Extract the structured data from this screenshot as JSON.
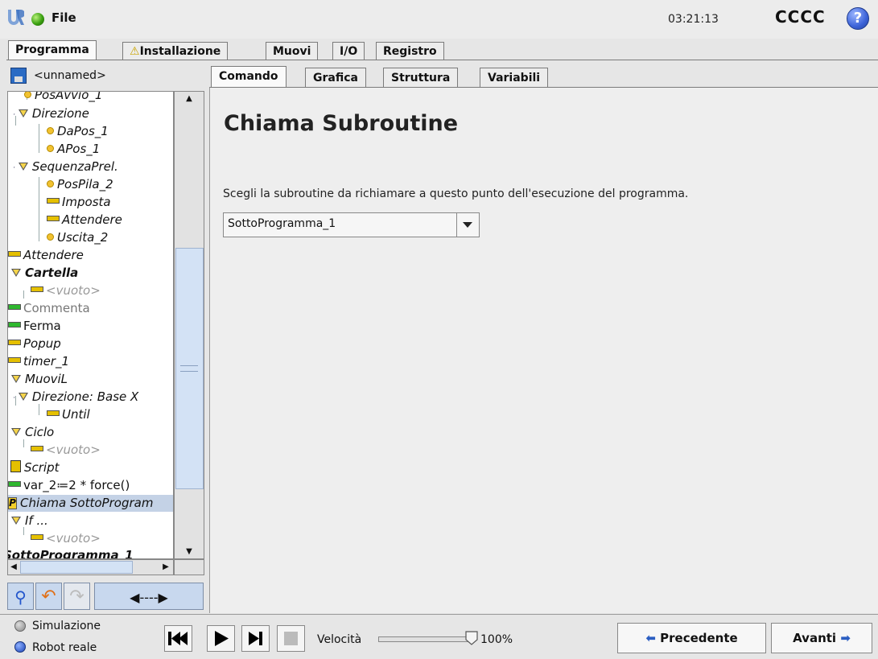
{
  "header": {
    "file_label": "File",
    "time": "03:21:13",
    "robot_name": "CCCC",
    "help_glyph": "?"
  },
  "main_tabs": [
    {
      "label": "Programma",
      "active": true
    },
    {
      "label": "Installazione",
      "warning": true
    },
    {
      "label": "Muovi"
    },
    {
      "label": "I/O"
    },
    {
      "label": "Registro"
    }
  ],
  "program": {
    "name": "<unnamed>"
  },
  "tree": [
    {
      "text": "PosAvvio_1",
      "icon": "waypoint-icon",
      "style": "italic"
    },
    {
      "text": "Direzione",
      "icon": "folder-triangle-icon",
      "style": "italic"
    },
    {
      "text": "DaPos_1",
      "icon": "waypoint-icon",
      "style": "italic"
    },
    {
      "text": "APos_1",
      "icon": "waypoint-icon",
      "style": "italic"
    },
    {
      "text": "SequenzaPrel.",
      "icon": "folder-triangle-icon",
      "style": "italic"
    },
    {
      "text": "PosPila_2",
      "icon": "waypoint-icon",
      "style": "italic"
    },
    {
      "text": "Imposta",
      "icon": "yellow-bar-icon",
      "style": "italic"
    },
    {
      "text": "Attendere",
      "icon": "yellow-bar-icon",
      "style": "italic"
    },
    {
      "text": "Uscita_2",
      "icon": "waypoint-icon",
      "style": "italic"
    },
    {
      "text": "Attendere",
      "icon": "yellow-bar-icon",
      "style": "italic"
    },
    {
      "text": "Cartella",
      "icon": "folder-triangle-icon",
      "style": "boldit"
    },
    {
      "text": "<vuoto>",
      "icon": "yellow-bar-icon",
      "style": "italic-gray"
    },
    {
      "text": "Commenta",
      "icon": "green-bar-icon",
      "style": "gray"
    },
    {
      "text": "Ferma",
      "icon": "green-bar-icon",
      "style": "normal"
    },
    {
      "text": "Popup",
      "icon": "yellow-bar-icon",
      "style": "italic"
    },
    {
      "text": "timer_1",
      "icon": "yellow-bar-icon",
      "style": "italic"
    },
    {
      "text": "MuoviL",
      "icon": "folder-triangle-icon",
      "style": "italic"
    },
    {
      "text": "Direzione: Base X",
      "icon": "folder-triangle-icon",
      "style": "italic"
    },
    {
      "text": "Until",
      "icon": "yellow-bar-icon",
      "style": "italic"
    },
    {
      "text": "Ciclo",
      "icon": "folder-triangle-icon",
      "style": "italic"
    },
    {
      "text": "<vuoto>",
      "icon": "yellow-bar-icon",
      "style": "italic-gray"
    },
    {
      "text": "Script",
      "icon": "script-icon",
      "style": "italic"
    },
    {
      "text": "var_2≔2 * force()",
      "icon": "green-bar-icon",
      "style": "normal"
    },
    {
      "text": "Chiama SottoProgram",
      "icon": "subprogram-icon",
      "style": "italic",
      "selected": true
    },
    {
      "text": "If ...",
      "icon": "folder-triangle-icon",
      "style": "italic"
    },
    {
      "text": "<vuoto>",
      "icon": "yellow-bar-icon",
      "style": "italic-gray"
    },
    {
      "text": "SottoProgramma_1",
      "icon": "none",
      "style": "boldit"
    }
  ],
  "sub_tabs": [
    {
      "label": "Comando",
      "active": true
    },
    {
      "label": "Grafica"
    },
    {
      "label": "Struttura"
    },
    {
      "label": "Variabili"
    }
  ],
  "command": {
    "title": "Chiama Subroutine",
    "description": "Scegli la subroutine da richiamare a questo punto dell'esecuzione del programma.",
    "selected_subroutine": "SottoProgramma_1"
  },
  "bottom": {
    "simulation_label": "Simulazione",
    "real_robot_label": "Robot reale",
    "speed_label": "Velocità",
    "speed_value": "100%",
    "speed_fraction": 1.0,
    "prev_label": "Precedente",
    "next_label": "Avanti"
  },
  "colors": {
    "accent": "#2a6bc4",
    "selection": "#c4d2e6",
    "button_blue": "#c8d8ee"
  }
}
